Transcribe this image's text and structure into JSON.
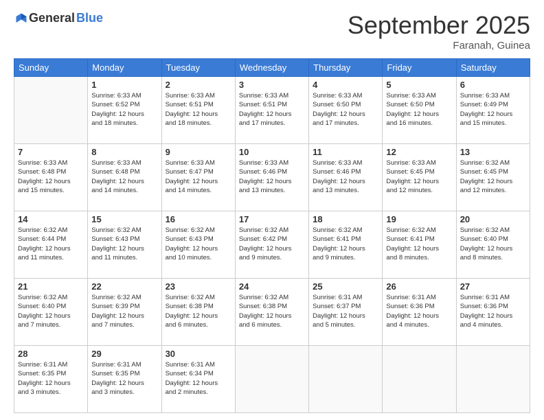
{
  "logo": {
    "general": "General",
    "blue": "Blue"
  },
  "header": {
    "month": "September 2025",
    "location": "Faranah, Guinea"
  },
  "days": [
    "Sunday",
    "Monday",
    "Tuesday",
    "Wednesday",
    "Thursday",
    "Friday",
    "Saturday"
  ],
  "weeks": [
    [
      {
        "day": "",
        "info": ""
      },
      {
        "day": "1",
        "info": "Sunrise: 6:33 AM\nSunset: 6:52 PM\nDaylight: 12 hours\nand 18 minutes."
      },
      {
        "day": "2",
        "info": "Sunrise: 6:33 AM\nSunset: 6:51 PM\nDaylight: 12 hours\nand 18 minutes."
      },
      {
        "day": "3",
        "info": "Sunrise: 6:33 AM\nSunset: 6:51 PM\nDaylight: 12 hours\nand 17 minutes."
      },
      {
        "day": "4",
        "info": "Sunrise: 6:33 AM\nSunset: 6:50 PM\nDaylight: 12 hours\nand 17 minutes."
      },
      {
        "day": "5",
        "info": "Sunrise: 6:33 AM\nSunset: 6:50 PM\nDaylight: 12 hours\nand 16 minutes."
      },
      {
        "day": "6",
        "info": "Sunrise: 6:33 AM\nSunset: 6:49 PM\nDaylight: 12 hours\nand 15 minutes."
      }
    ],
    [
      {
        "day": "7",
        "info": "Sunrise: 6:33 AM\nSunset: 6:48 PM\nDaylight: 12 hours\nand 15 minutes."
      },
      {
        "day": "8",
        "info": "Sunrise: 6:33 AM\nSunset: 6:48 PM\nDaylight: 12 hours\nand 14 minutes."
      },
      {
        "day": "9",
        "info": "Sunrise: 6:33 AM\nSunset: 6:47 PM\nDaylight: 12 hours\nand 14 minutes."
      },
      {
        "day": "10",
        "info": "Sunrise: 6:33 AM\nSunset: 6:46 PM\nDaylight: 12 hours\nand 13 minutes."
      },
      {
        "day": "11",
        "info": "Sunrise: 6:33 AM\nSunset: 6:46 PM\nDaylight: 12 hours\nand 13 minutes."
      },
      {
        "day": "12",
        "info": "Sunrise: 6:33 AM\nSunset: 6:45 PM\nDaylight: 12 hours\nand 12 minutes."
      },
      {
        "day": "13",
        "info": "Sunrise: 6:32 AM\nSunset: 6:45 PM\nDaylight: 12 hours\nand 12 minutes."
      }
    ],
    [
      {
        "day": "14",
        "info": "Sunrise: 6:32 AM\nSunset: 6:44 PM\nDaylight: 12 hours\nand 11 minutes."
      },
      {
        "day": "15",
        "info": "Sunrise: 6:32 AM\nSunset: 6:43 PM\nDaylight: 12 hours\nand 11 minutes."
      },
      {
        "day": "16",
        "info": "Sunrise: 6:32 AM\nSunset: 6:43 PM\nDaylight: 12 hours\nand 10 minutes."
      },
      {
        "day": "17",
        "info": "Sunrise: 6:32 AM\nSunset: 6:42 PM\nDaylight: 12 hours\nand 9 minutes."
      },
      {
        "day": "18",
        "info": "Sunrise: 6:32 AM\nSunset: 6:41 PM\nDaylight: 12 hours\nand 9 minutes."
      },
      {
        "day": "19",
        "info": "Sunrise: 6:32 AM\nSunset: 6:41 PM\nDaylight: 12 hours\nand 8 minutes."
      },
      {
        "day": "20",
        "info": "Sunrise: 6:32 AM\nSunset: 6:40 PM\nDaylight: 12 hours\nand 8 minutes."
      }
    ],
    [
      {
        "day": "21",
        "info": "Sunrise: 6:32 AM\nSunset: 6:40 PM\nDaylight: 12 hours\nand 7 minutes."
      },
      {
        "day": "22",
        "info": "Sunrise: 6:32 AM\nSunset: 6:39 PM\nDaylight: 12 hours\nand 7 minutes."
      },
      {
        "day": "23",
        "info": "Sunrise: 6:32 AM\nSunset: 6:38 PM\nDaylight: 12 hours\nand 6 minutes."
      },
      {
        "day": "24",
        "info": "Sunrise: 6:32 AM\nSunset: 6:38 PM\nDaylight: 12 hours\nand 6 minutes."
      },
      {
        "day": "25",
        "info": "Sunrise: 6:31 AM\nSunset: 6:37 PM\nDaylight: 12 hours\nand 5 minutes."
      },
      {
        "day": "26",
        "info": "Sunrise: 6:31 AM\nSunset: 6:36 PM\nDaylight: 12 hours\nand 4 minutes."
      },
      {
        "day": "27",
        "info": "Sunrise: 6:31 AM\nSunset: 6:36 PM\nDaylight: 12 hours\nand 4 minutes."
      }
    ],
    [
      {
        "day": "28",
        "info": "Sunrise: 6:31 AM\nSunset: 6:35 PM\nDaylight: 12 hours\nand 3 minutes."
      },
      {
        "day": "29",
        "info": "Sunrise: 6:31 AM\nSunset: 6:35 PM\nDaylight: 12 hours\nand 3 minutes."
      },
      {
        "day": "30",
        "info": "Sunrise: 6:31 AM\nSunset: 6:34 PM\nDaylight: 12 hours\nand 2 minutes."
      },
      {
        "day": "",
        "info": ""
      },
      {
        "day": "",
        "info": ""
      },
      {
        "day": "",
        "info": ""
      },
      {
        "day": "",
        "info": ""
      }
    ]
  ]
}
